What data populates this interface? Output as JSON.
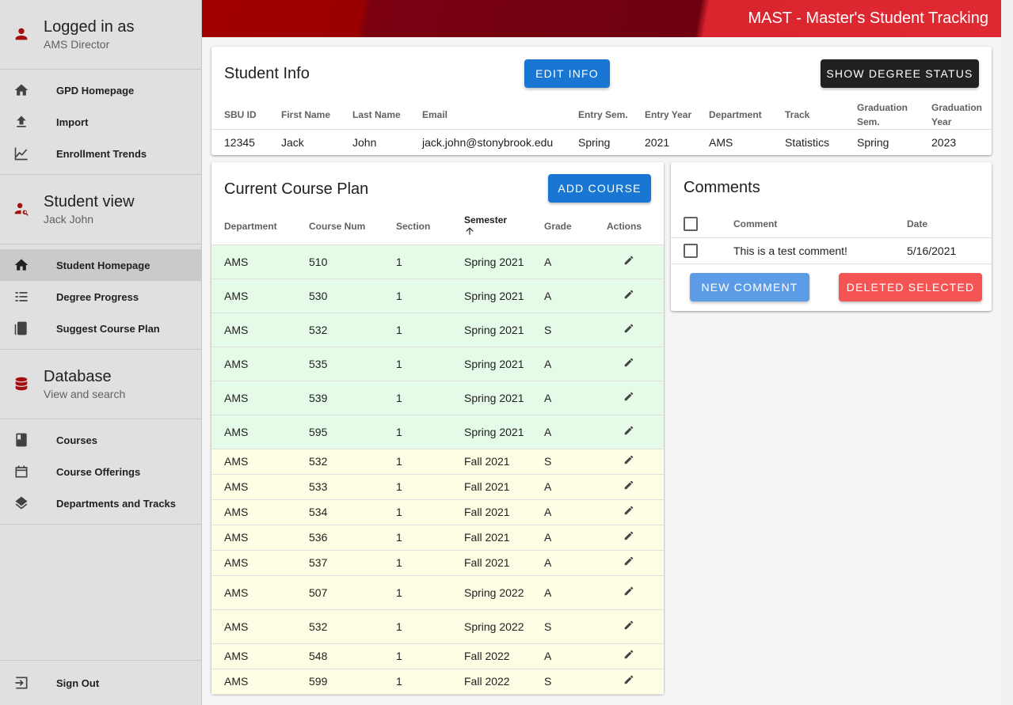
{
  "app": {
    "title": "MAST - Master's Student Tracking"
  },
  "colors": {
    "primary": "#1976d2",
    "dark": "#212121",
    "danger": "#f44336",
    "accent_red": "#a50f0f",
    "passed_row": "#e6fbe7",
    "planned_row": "#fefee4"
  },
  "sidebar": {
    "user": {
      "title": "Logged in as",
      "subtitle": "AMS Director",
      "icon": "person-icon"
    },
    "gpd_items": [
      {
        "label": "GPD Homepage",
        "icon": "home-icon"
      },
      {
        "label": "Import",
        "icon": "upload-icon"
      },
      {
        "label": "Enrollment Trends",
        "icon": "chart-icon"
      }
    ],
    "student": {
      "title": "Student view",
      "subtitle": "Jack John",
      "icon": "person-search-icon"
    },
    "student_items": [
      {
        "label": "Student Homepage",
        "icon": "home-icon",
        "active": true
      },
      {
        "label": "Degree Progress",
        "icon": "list-icon"
      },
      {
        "label": "Suggest Course Plan",
        "icon": "book-icon"
      }
    ],
    "database": {
      "title": "Database",
      "subtitle": "View and search",
      "icon": "database-icon"
    },
    "db_items": [
      {
        "label": "Courses",
        "icon": "book-icon"
      },
      {
        "label": "Course Offerings",
        "icon": "calendar-icon"
      },
      {
        "label": "Departments and Tracks",
        "icon": "layers-icon"
      }
    ],
    "signout": {
      "label": "Sign Out",
      "icon": "signout-icon"
    }
  },
  "student_info": {
    "title": "Student Info",
    "edit_label": "Edit Info",
    "degree_status_label": "Show Degree Status",
    "headers": [
      "SBU ID",
      "First Name",
      "Last Name",
      "Email",
      "Entry Sem.",
      "Entry Year",
      "Department",
      "Track",
      "Graduation Sem.",
      "Graduation Year"
    ],
    "values": [
      "12345",
      "Jack",
      "John",
      "jack.john@stonybrook.edu",
      "Spring",
      "2021",
      "AMS",
      "Statistics",
      "Spring",
      "2023"
    ]
  },
  "course_plan": {
    "title": "Current Course Plan",
    "add_label": "Add Course",
    "headers": [
      "Department",
      "Course Num",
      "Section",
      "Semester",
      "Grade",
      "Actions"
    ],
    "rows": [
      {
        "dept": "AMS",
        "num": "510",
        "section": "1",
        "semester": "Spring 2021",
        "grade": "A",
        "status": "passed"
      },
      {
        "dept": "AMS",
        "num": "530",
        "section": "1",
        "semester": "Spring 2021",
        "grade": "A",
        "status": "passed"
      },
      {
        "dept": "AMS",
        "num": "532",
        "section": "1",
        "semester": "Spring 2021",
        "grade": "S",
        "status": "passed"
      },
      {
        "dept": "AMS",
        "num": "535",
        "section": "1",
        "semester": "Spring 2021",
        "grade": "A",
        "status": "passed"
      },
      {
        "dept": "AMS",
        "num": "539",
        "section": "1",
        "semester": "Spring 2021",
        "grade": "A",
        "status": "passed"
      },
      {
        "dept": "AMS",
        "num": "595",
        "section": "1",
        "semester": "Spring 2021",
        "grade": "A",
        "status": "passed"
      },
      {
        "dept": "AMS",
        "num": "532",
        "section": "1",
        "semester": "Fall 2021",
        "grade": "S",
        "status": "planned"
      },
      {
        "dept": "AMS",
        "num": "533",
        "section": "1",
        "semester": "Fall 2021",
        "grade": "A",
        "status": "planned"
      },
      {
        "dept": "AMS",
        "num": "534",
        "section": "1",
        "semester": "Fall 2021",
        "grade": "A",
        "status": "planned"
      },
      {
        "dept": "AMS",
        "num": "536",
        "section": "1",
        "semester": "Fall 2021",
        "grade": "A",
        "status": "planned"
      },
      {
        "dept": "AMS",
        "num": "537",
        "section": "1",
        "semester": "Fall 2021",
        "grade": "A",
        "status": "planned"
      },
      {
        "dept": "AMS",
        "num": "507",
        "section": "1",
        "semester": "Spring 2022",
        "grade": "A",
        "status": "planned"
      },
      {
        "dept": "AMS",
        "num": "532",
        "section": "1",
        "semester": "Spring 2022",
        "grade": "S",
        "status": "planned"
      },
      {
        "dept": "AMS",
        "num": "548",
        "section": "1",
        "semester": "Fall 2022",
        "grade": "A",
        "status": "planned"
      },
      {
        "dept": "AMS",
        "num": "599",
        "section": "1",
        "semester": "Fall 2022",
        "grade": "S",
        "status": "planned"
      }
    ]
  },
  "comments": {
    "title": "Comments",
    "headers": [
      "Comment",
      "Date"
    ],
    "rows": [
      {
        "comment": "This is a test comment!",
        "date": "5/16/2021"
      }
    ],
    "new_label": "New Comment",
    "delete_label": "Deleted Selected"
  }
}
